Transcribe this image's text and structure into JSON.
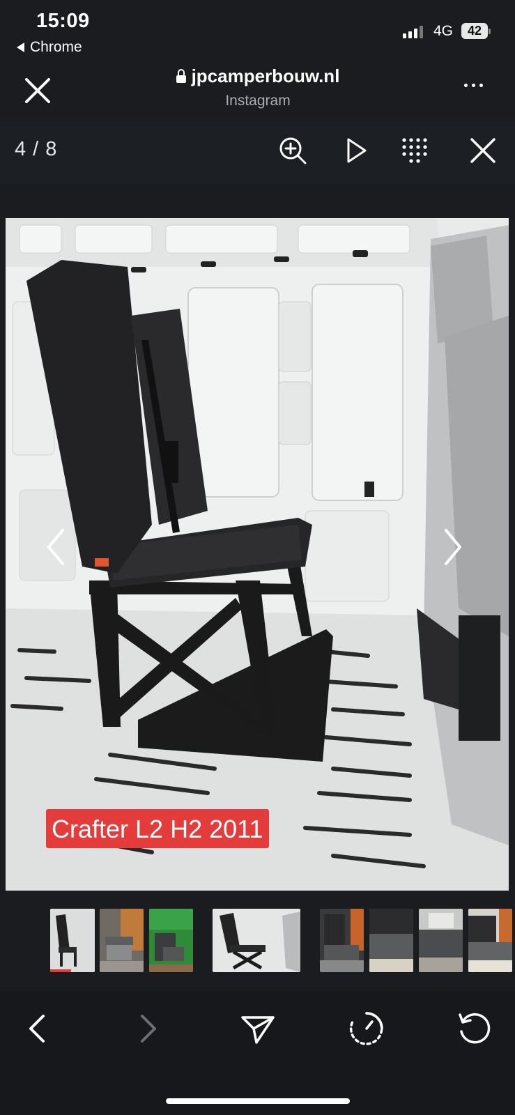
{
  "status_bar": {
    "time": "15:09",
    "back_app": "Chrome",
    "network": "4G",
    "battery": "42"
  },
  "browser": {
    "url": "jpcamperbouw.nl",
    "subtitle": "Instagram",
    "close_icon": "close-icon",
    "more_icon": "more-icon"
  },
  "viewer": {
    "counter": "4 / 8",
    "tools": [
      "zoom-in-icon",
      "play-icon",
      "grid-icon",
      "close-icon"
    ]
  },
  "image": {
    "caption": "Crafter L2 H2 2011",
    "caption_color": "#e43b3b"
  },
  "thumbnails": {
    "count": 8,
    "active_index": 0
  },
  "bottom_nav": {
    "items": [
      "back-icon",
      "forward-icon",
      "share-icon",
      "timer-icon",
      "reload-icon"
    ]
  }
}
